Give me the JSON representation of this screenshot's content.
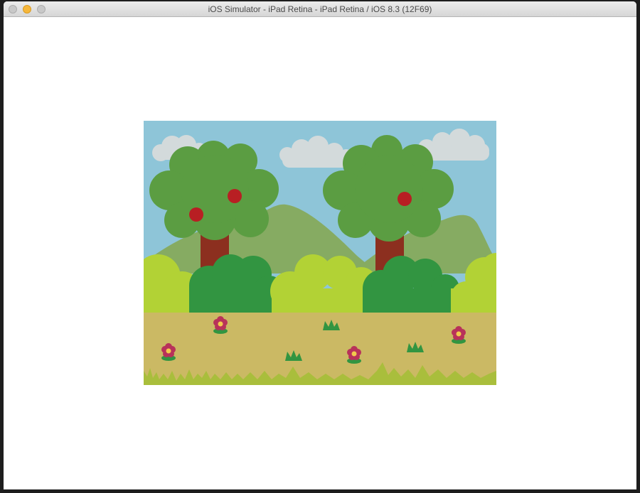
{
  "window": {
    "title": "iOS Simulator - iPad Retina - iPad Retina / iOS 8.3 (12F69)",
    "traffic_lights": [
      "close",
      "minimize",
      "zoom"
    ]
  },
  "scene": {
    "description_icons": [
      "cloud-icon",
      "tree-icon",
      "apple-icon",
      "mountain-icon",
      "bush-icon",
      "flower-icon",
      "grass-tuft-icon"
    ],
    "colors": {
      "sky": "#8ec5d8",
      "cloud": "#d3dadb",
      "mountain": "#86ab62",
      "tree_foliage": "#5b9d42",
      "tree_trunk": "#8c2f1f",
      "apple": "#b81f23",
      "bush_light": "#b2d235",
      "bush_dark": "#329541",
      "ground": "#cbb964",
      "grass": "#a9be3c",
      "flower": "#b8325a",
      "flower_center": "#f2c94c"
    }
  }
}
